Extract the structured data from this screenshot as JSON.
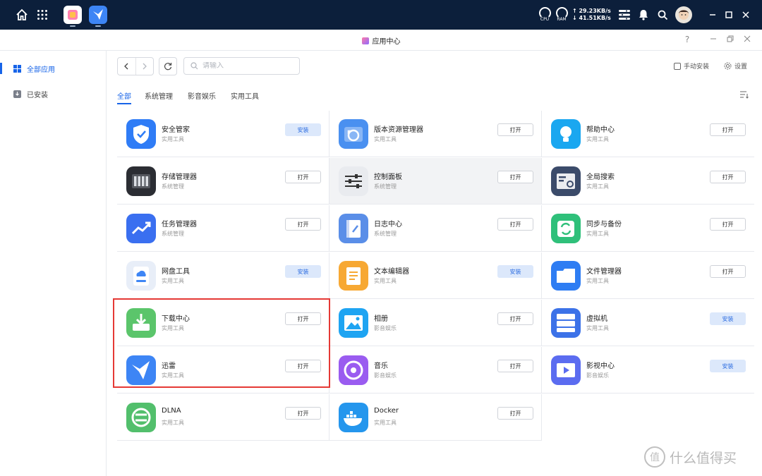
{
  "topbar": {
    "gauges": [
      "CPU",
      "RAM"
    ],
    "upload_speed": "↑ 29.23KB/s",
    "download_speed": "↓ 41.51KB/s"
  },
  "window": {
    "title": "应用中心",
    "help": "?"
  },
  "sidebar": {
    "items": [
      {
        "label": "全部应用",
        "active": true
      },
      {
        "label": "已安装",
        "active": false
      }
    ]
  },
  "toolbar": {
    "search_placeholder": "请输入",
    "manual_install": "手动安装",
    "settings": "设置"
  },
  "tabs": [
    {
      "label": "全部",
      "active": true
    },
    {
      "label": "系统管理",
      "active": false
    },
    {
      "label": "影音娱乐",
      "active": false
    },
    {
      "label": "实用工具",
      "active": false
    }
  ],
  "apps": [
    {
      "name": "安全管家",
      "category": "实用工具",
      "button": "安装",
      "icon": "shield-icon",
      "color": "#2f7cf6"
    },
    {
      "name": "版本资源管理器",
      "category": "实用工具",
      "button": "打开",
      "icon": "folder-restore-icon",
      "color": "#4a90f0"
    },
    {
      "name": "帮助中心",
      "category": "实用工具",
      "button": "打开",
      "icon": "lightbulb-icon",
      "color": "#1aa7f0"
    },
    {
      "name": "存储管理器",
      "category": "系统管理",
      "button": "打开",
      "icon": "storage-icon",
      "color": "#2b2d33"
    },
    {
      "name": "控制面板",
      "category": "系统管理",
      "button": "打开",
      "icon": "sliders-icon",
      "color": "#e9ebef"
    },
    {
      "name": "全局搜索",
      "category": "实用工具",
      "button": "打开",
      "icon": "search-panel-icon",
      "color": "#3b4b6a"
    },
    {
      "name": "任务管理器",
      "category": "系统管理",
      "button": "打开",
      "icon": "trend-icon",
      "color": "#3a6ff0"
    },
    {
      "name": "日志中心",
      "category": "系统管理",
      "button": "打开",
      "icon": "log-book-icon",
      "color": "#5a8ee8"
    },
    {
      "name": "同步与备份",
      "category": "实用工具",
      "button": "打开",
      "icon": "sync-icon",
      "color": "#2fc07a"
    },
    {
      "name": "网盘工具",
      "category": "实用工具",
      "button": "安装",
      "icon": "cloud-drive-icon",
      "color": "#e8eef8"
    },
    {
      "name": "文本编辑器",
      "category": "实用工具",
      "button": "安装",
      "icon": "document-icon",
      "color": "#f7a833"
    },
    {
      "name": "文件管理器",
      "category": "实用工具",
      "button": "打开",
      "icon": "folder-icon",
      "color": "#2e7df3"
    },
    {
      "name": "下载中心",
      "category": "实用工具",
      "button": "打开",
      "icon": "download-icon",
      "color": "#5bc56b"
    },
    {
      "name": "相册",
      "category": "影音娱乐",
      "button": "打开",
      "icon": "photo-icon",
      "color": "#1ea4f2"
    },
    {
      "name": "虚拟机",
      "category": "实用工具",
      "button": "安装",
      "icon": "server-icon",
      "color": "#3c72e8"
    },
    {
      "name": "迅雷",
      "category": "实用工具",
      "button": "打开",
      "icon": "thunder-bird-icon",
      "color": "#3d85f5"
    },
    {
      "name": "音乐",
      "category": "影音娱乐",
      "button": "打开",
      "icon": "music-disc-icon",
      "color": "#9a5cf0"
    },
    {
      "name": "影视中心",
      "category": "影音娱乐",
      "button": "安装",
      "icon": "video-icon",
      "color": "#5b6cf0"
    },
    {
      "name": "DLNA",
      "category": "实用工具",
      "button": "打开",
      "icon": "dlna-icon",
      "color": "#52bf6c"
    },
    {
      "name": "Docker",
      "category": "实用工具",
      "button": "打开",
      "icon": "docker-whale-icon",
      "color": "#2496ed"
    }
  ],
  "watermark": "什么值得买"
}
